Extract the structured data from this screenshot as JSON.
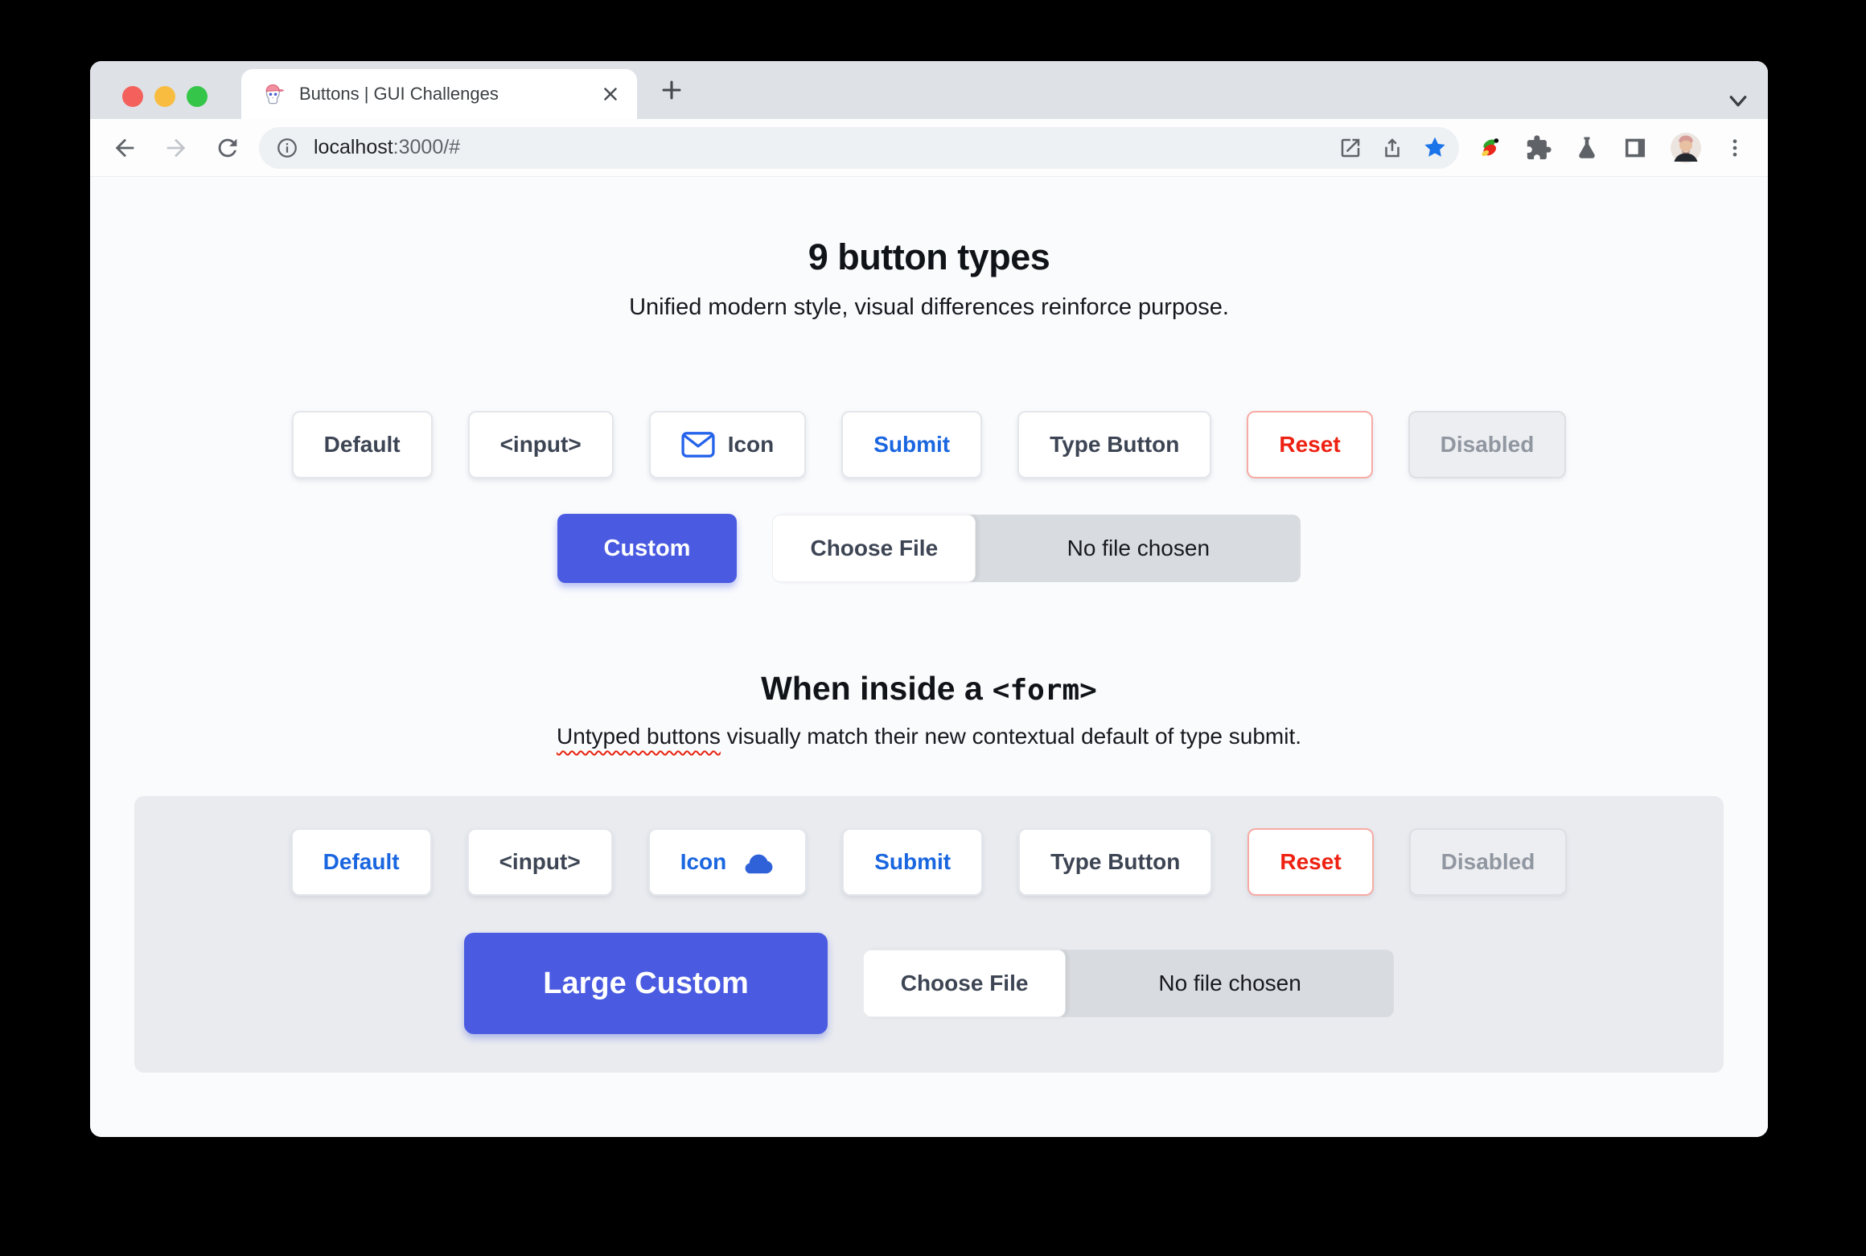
{
  "browser": {
    "tab_title": "Buttons | GUI Challenges",
    "url_host": "localhost",
    "url_rest": ":3000/#"
  },
  "intro": {
    "title": "9 button types",
    "subtitle": "Unified modern style, visual differences reinforce purpose."
  },
  "demo": {
    "buttons": {
      "default": "Default",
      "input": "<input>",
      "icon": "Icon",
      "submit": "Submit",
      "type_button": "Type Button",
      "reset": "Reset",
      "disabled": "Disabled"
    },
    "custom": "Custom",
    "file": {
      "button": "Choose File",
      "status": "No file chosen"
    }
  },
  "form": {
    "title_text": "When inside a",
    "title_code": "<form>",
    "subtitle_marked": "Untyped buttons",
    "subtitle_rest": " visually match their new contextual default of type submit.",
    "buttons": {
      "default": "Default",
      "input": "<input>",
      "icon": "Icon",
      "submit": "Submit",
      "type_button": "Type Button",
      "reset": "Reset",
      "disabled": "Disabled"
    },
    "custom": "Large Custom",
    "file": {
      "button": "Choose File",
      "status": "No file chosen"
    }
  },
  "colors": {
    "accent_blue": "#1a66e0",
    "custom_button_blue": "#4a5be1",
    "reset_red": "#ee2112",
    "reset_border_pink": "#f8aba4",
    "bookmark_star_blue": "#1a73e8"
  }
}
